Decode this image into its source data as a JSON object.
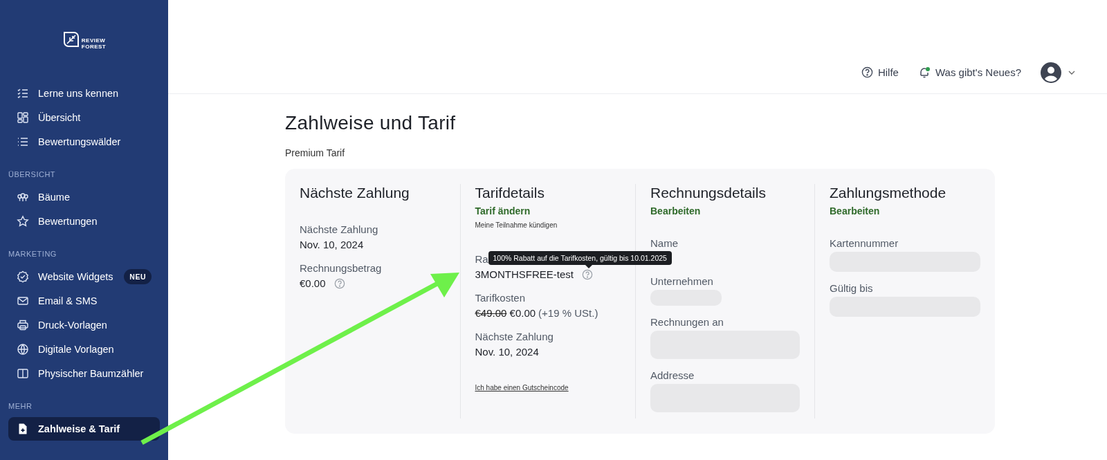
{
  "sidebar": {
    "logo": [
      "REVIEW",
      "FOREST"
    ],
    "sections": [
      {
        "items": [
          {
            "label": "Lerne uns kennen",
            "selected": false
          },
          {
            "label": "Übersicht",
            "selected": false
          },
          {
            "label": "Bewertungswälder",
            "selected": false
          }
        ]
      },
      {
        "heading": "ÜBERSICHT",
        "items": [
          {
            "label": "Bäume",
            "selected": false
          },
          {
            "label": "Bewertungen",
            "selected": false
          }
        ]
      },
      {
        "heading": "MARKETING",
        "items": [
          {
            "label": "Website Widgets",
            "selected": false,
            "badge": "NEU"
          },
          {
            "label": "Email & SMS",
            "selected": false
          },
          {
            "label": "Druck-Vorlagen",
            "selected": false
          },
          {
            "label": "Digitale Vorlagen",
            "selected": false
          },
          {
            "label": "Physischer Baumzähler",
            "selected": false
          }
        ]
      },
      {
        "heading": "MEHR",
        "items": [
          {
            "label": "Zahlweise & Tarif",
            "selected": true
          }
        ]
      }
    ]
  },
  "header": {
    "help": "Hilfe",
    "news": "Was gibt's Neues?",
    "news_unread": true
  },
  "page": {
    "title": "Zahlweise und Tarif",
    "subtitle": "Premium Tarif"
  },
  "columns": [
    {
      "title": "Nächste Zahlung",
      "fields": [
        {
          "kind": "text",
          "label": "Nächste Zahlung",
          "value": "Nov. 10, 2024"
        },
        {
          "kind": "text",
          "label": "Rechnungsbetrag",
          "value": "€0.00",
          "help": true
        }
      ]
    },
    {
      "title": "Tarifdetails",
      "link": "Tarif ändern",
      "sublink": "Meine Teilnahme kündigen",
      "fields": [
        {
          "kind": "text",
          "label": "Ra",
          "value": "3MONTHSFREE-test",
          "help": true,
          "tooltip": "100% Rabatt auf die Tarifkosten, gültig bis 10.01.2025"
        },
        {
          "kind": "price",
          "label": "Tarifkosten",
          "old": "€49.00",
          "value": "€0.00",
          "note": "(+19 % USt.)"
        },
        {
          "kind": "text",
          "label": "Nächste Zahlung",
          "value": "Nov. 10, 2024"
        }
      ],
      "footer_link": "Ich habe einen Gutscheincode"
    },
    {
      "title": "Rechnungsdetails",
      "link": "Bearbeiten",
      "fields": [
        {
          "kind": "label",
          "label": "Name"
        },
        {
          "kind": "short",
          "label": "Unternehmen"
        },
        {
          "kind": "tall",
          "label": "Rechnungen an"
        },
        {
          "kind": "tall",
          "label": "Addresse"
        }
      ]
    },
    {
      "title": "Zahlungsmethode",
      "link": "Bearbeiten",
      "fields": [
        {
          "kind": "wide",
          "label": "Kartennummer"
        },
        {
          "kind": "wide",
          "label": "Gültig bis"
        }
      ]
    }
  ]
}
